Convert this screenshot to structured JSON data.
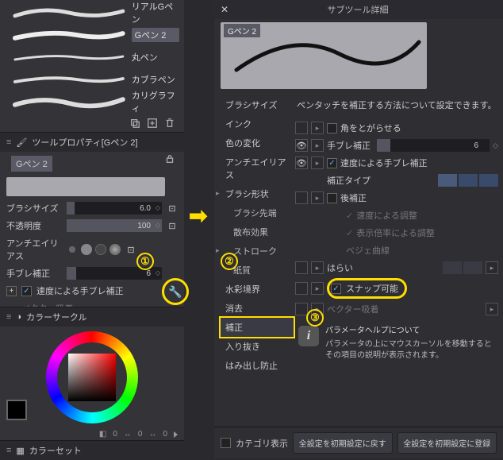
{
  "left": {
    "brushes": [
      {
        "name": "リアルGペン"
      },
      {
        "name": "Gペン 2"
      },
      {
        "name": "丸ペン"
      },
      {
        "name": "カブラペン"
      },
      {
        "name": "カリグラフィ"
      }
    ],
    "tool_property_header": "ツールプロパティ[Gペン 2]",
    "tp_title": "Gペン 2",
    "props": {
      "brush_size_label": "ブラシサイズ",
      "brush_size_value": "6.0",
      "opacity_label": "不透明度",
      "opacity_value": "100",
      "aa_label": "アンチエイリアス",
      "stabilize_label": "手ブレ補正",
      "stabilize_value": "6",
      "speed_stabilize_label": "速度による手ブレ補正",
      "vector_snap_label": "ベクター吸着"
    },
    "color_circle_header": "カラーサークル",
    "color_set_header": "カラーセット",
    "readout_zero": "0"
  },
  "annot": {
    "n1": "①",
    "n2": "②",
    "n3": "③"
  },
  "right": {
    "title": "サブツール詳細",
    "preview_label": "Gペン 2",
    "cats": {
      "brush_size": "ブラシサイズ",
      "ink": "インク",
      "color_change": "色の変化",
      "antialias": "アンチエイリアス",
      "brush_shape": "ブラシ形状",
      "brush_tip": "ブラシ先端",
      "scatter": "散布効果",
      "stroke": "ストローク",
      "paper": "紙質",
      "wc_edge": "水彩境界",
      "erase": "消去",
      "correction": "補正",
      "inout": "入り抜き",
      "overflow": "はみ出し防止"
    },
    "hint": "ペンタッチを補正する方法について設定できます。",
    "props": {
      "corner_label": "角をとがらせる",
      "stabilize_label": "手ブレ補正",
      "stabilize_value": "6",
      "speed_label": "速度による手ブレ補正",
      "type_label": "補正タイプ",
      "post_label": "後補正",
      "by_speed": "速度による調整",
      "by_zoom": "表示倍率による調整",
      "bezier": "ベジェ曲線",
      "brush_pay": "はらい",
      "snap_label": "スナップ可能",
      "vector_snap": "ベクター吸着"
    },
    "info_title": "パラメータヘルプについて",
    "info_body": "パラメータの上にマウスカーソルを移動するとその項目の説明が表示されます。",
    "category_show": "カテゴリ表示",
    "btn_reset": "全設定を初期設定に戻す",
    "btn_register": "全設定を初期設定に登録"
  }
}
